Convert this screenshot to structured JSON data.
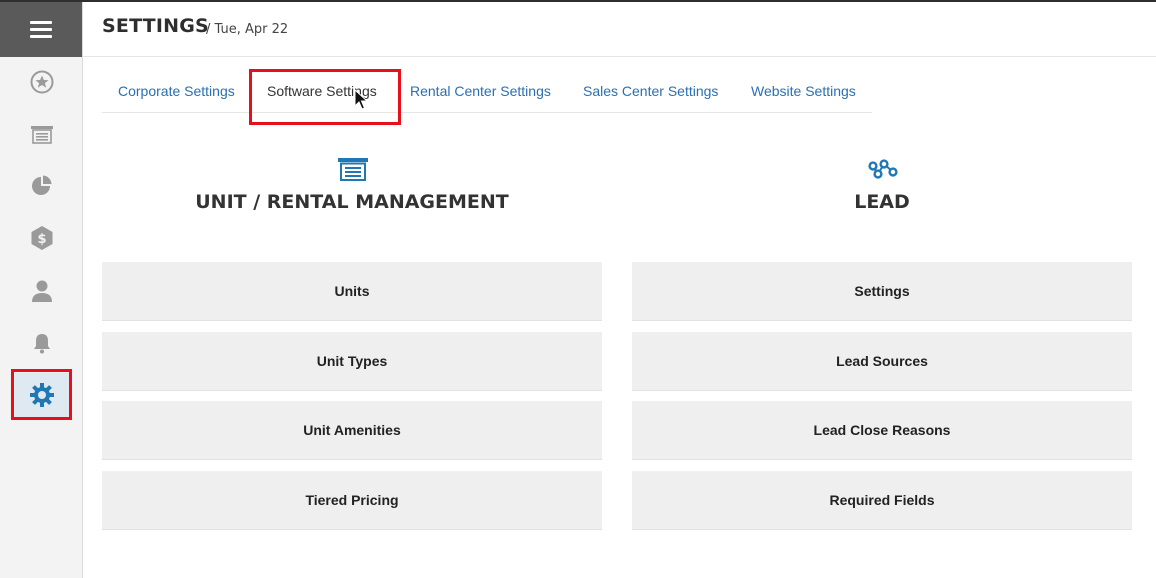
{
  "header": {
    "title": "SETTINGS",
    "date": "/ Tue, Apr 22"
  },
  "sidebar": {
    "items": [
      {
        "icon": "star-icon"
      },
      {
        "icon": "unit-list-icon"
      },
      {
        "icon": "pie-chart-icon"
      },
      {
        "icon": "dollar-hexagon-icon"
      },
      {
        "icon": "user-icon"
      },
      {
        "icon": "bell-icon"
      },
      {
        "icon": "gear-icon",
        "active": true
      }
    ]
  },
  "tabs": [
    {
      "label": "Corporate Settings"
    },
    {
      "label": "Software Settings",
      "active": true
    },
    {
      "label": "Rental Center Settings"
    },
    {
      "label": "Sales Center Settings"
    },
    {
      "label": "Website Settings"
    }
  ],
  "sections": {
    "unit": {
      "title": "UNIT / RENTAL MANAGEMENT",
      "icon": "storage-unit-icon",
      "buttons": [
        "Units",
        "Unit Types",
        "Unit Amenities",
        "Tiered Pricing"
      ]
    },
    "lead": {
      "title": "LEAD",
      "icon": "lead-network-icon",
      "buttons": [
        "Settings",
        "Lead Sources",
        "Lead Close Reasons",
        "Required Fields"
      ]
    }
  },
  "colors": {
    "accent": "#1f78b4",
    "link": "#2a6fb3",
    "highlight": "#e5101b",
    "tile": "#efefef"
  }
}
